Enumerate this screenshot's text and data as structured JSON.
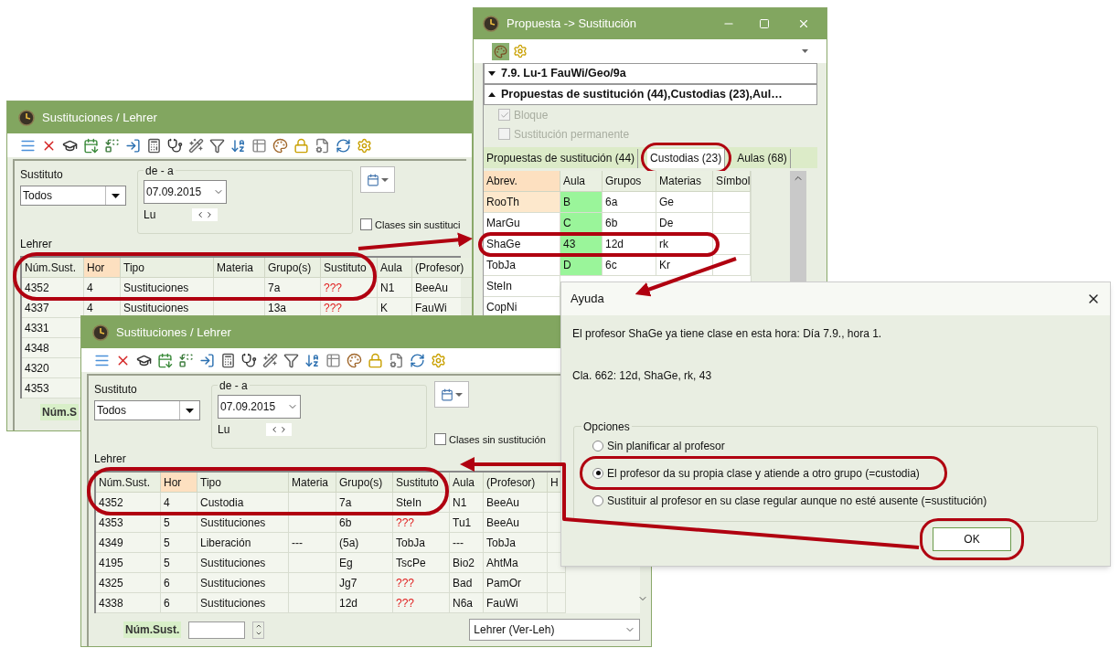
{
  "back_window": {
    "title": "Sustituciones / Lehrer",
    "substitute_label": "Sustituto",
    "substitute_value": "Todos",
    "range_label": "de - a",
    "date": "07.09.2015",
    "weekday": "Lu",
    "checkbox_label": "Clases sin sustituci",
    "checkbox_checked": false,
    "table_caption": "Lehrer",
    "columns": [
      {
        "label": "Núm.Sust.",
        "kind": "plain",
        "sorted": false
      },
      {
        "label": "Hor",
        "kind": "plain",
        "sorted": true
      },
      {
        "label": "Tipo",
        "kind": "plain",
        "sorted": false
      },
      {
        "label": "Materia",
        "kind": "plain",
        "sorted": false
      },
      {
        "label": "Grupo(s)",
        "kind": "plain",
        "sorted": false
      },
      {
        "label": "Sustituto",
        "kind": "substitute",
        "sorted": false
      },
      {
        "label": "Aula",
        "kind": "plain",
        "sorted": false
      },
      {
        "label": "(Profesor)",
        "kind": "plain",
        "sorted": false
      }
    ],
    "rows": [
      {
        "cells": [
          "4352",
          "4",
          "Sustituciones",
          "",
          "7a",
          "???",
          "N1",
          "BeeAu"
        ],
        "missing": true
      },
      {
        "cells": [
          "4337",
          "4",
          "Sustituciones",
          "",
          "13a",
          "???",
          "K",
          "FauWi"
        ],
        "missing": true
      },
      {
        "cells": [
          "4331"
        ]
      },
      {
        "cells": [
          "4348"
        ]
      },
      {
        "cells": [
          "4320"
        ]
      },
      {
        "cells": [
          "4353"
        ]
      }
    ],
    "footer_label": "Núm.S"
  },
  "proposal_window": {
    "title": "Propuesta -> Sustitución",
    "sections": [
      {
        "label": "7.9. Lu-1 FauWi/Geo/9a",
        "expanded": false
      },
      {
        "label": "Propuestas de sustitución (44),Custodias (23),Aul…",
        "expanded": true
      }
    ],
    "options": [
      {
        "label": "Bloque",
        "checked": true,
        "disabled": true
      },
      {
        "label": "Sustitución permanente",
        "checked": false,
        "disabled": true
      }
    ],
    "tabs": [
      {
        "label": "Propuestas de sustitución (44)",
        "selected": false
      },
      {
        "label": "Custodias (23)",
        "selected": true
      },
      {
        "label": "Aulas (68)",
        "selected": false
      }
    ],
    "columns": [
      "Abrev.",
      "Aula",
      "Grupos",
      "Materias",
      "Símbol"
    ],
    "rows": [
      {
        "cells": [
          "RooTh",
          "B",
          "6a",
          "Ge",
          ""
        ],
        "selected": true
      },
      {
        "cells": [
          "MarGu",
          "C",
          "6b",
          "De",
          ""
        ],
        "selected": false
      },
      {
        "cells": [
          "ShaGe",
          "43",
          "12d",
          "rk",
          ""
        ],
        "selected": false
      },
      {
        "cells": [
          "TobJa",
          "D",
          "6c",
          "Kr",
          ""
        ],
        "selected": false
      },
      {
        "cells": [
          "SteIn"
        ],
        "selected": false
      },
      {
        "cells": [
          "CopNi"
        ],
        "selected": false
      }
    ]
  },
  "front_window": {
    "title": "Sustituciones / Lehrer",
    "substitute_label": "Sustituto",
    "substitute_value": "Todos",
    "range_label": "de - a",
    "date": "07.09.2015",
    "weekday": "Lu",
    "checkbox_label": "Clases sin sustitución",
    "checkbox_checked": false,
    "table_caption": "Lehrer",
    "columns": [
      {
        "label": "Núm.Sust.",
        "kind": "plain",
        "sorted": false
      },
      {
        "label": "Hor",
        "kind": "plain",
        "sorted": true
      },
      {
        "label": "Tipo",
        "kind": "plain",
        "sorted": false
      },
      {
        "label": "Materia",
        "kind": "plain",
        "sorted": false
      },
      {
        "label": "Grupo(s)",
        "kind": "plain",
        "sorted": false
      },
      {
        "label": "Sustituto",
        "kind": "substitute",
        "sorted": false
      },
      {
        "label": "Aula",
        "kind": "plain",
        "sorted": false
      },
      {
        "label": "(Profesor)",
        "kind": "plain",
        "sorted": false
      },
      {
        "label": "H",
        "kind": "plain",
        "sorted": false
      }
    ],
    "rows": [
      {
        "cells": [
          "4352",
          "4",
          "Custodia",
          "",
          "7a",
          "SteIn",
          "N1",
          "BeeAu",
          ""
        ],
        "missing": false
      },
      {
        "cells": [
          "4353",
          "5",
          "Sustituciones",
          "",
          "6b",
          "???",
          "Tu1",
          "BeeAu",
          ""
        ],
        "missing": true
      },
      {
        "cells": [
          "4349",
          "5",
          "Liberación",
          "---",
          "(5a)",
          "TobJa",
          "---",
          "TobJa",
          ""
        ],
        "missing": false
      },
      {
        "cells": [
          "4195",
          "5",
          "Sustituciones",
          "",
          "Eg",
          "TscPe",
          "Bio2",
          "AhtMa",
          ""
        ],
        "missing": false
      },
      {
        "cells": [
          "4325",
          "6",
          "Sustituciones",
          "",
          "Jg7",
          "???",
          "Bad",
          "PamOr",
          ""
        ],
        "missing": true
      },
      {
        "cells": [
          "4338",
          "6",
          "Sustituciones",
          "",
          "12d",
          "???",
          "N6a",
          "FauWi",
          ""
        ],
        "missing": true
      }
    ],
    "footer_label": "Núm.Sust.",
    "view_value": "Lehrer (Ver-Leh)"
  },
  "help_dialog": {
    "title": "Ayuda",
    "message": "El profesor ShaGe ya tiene clase en esta hora: Día 7.9., hora 1.",
    "detail": "Cla. 662: 12d, ShaGe, rk, 43",
    "group_label": "Opciones",
    "options": [
      {
        "label": "Sin planificar al profesor",
        "selected": false
      },
      {
        "label": "El profesor da su propia clase y atiende a otro grupo (=custodia)",
        "selected": true
      },
      {
        "label": "Sustituir al profesor en su clase regular aunque no esté ausente (=sustitución)",
        "selected": false
      }
    ],
    "button": "OK"
  }
}
